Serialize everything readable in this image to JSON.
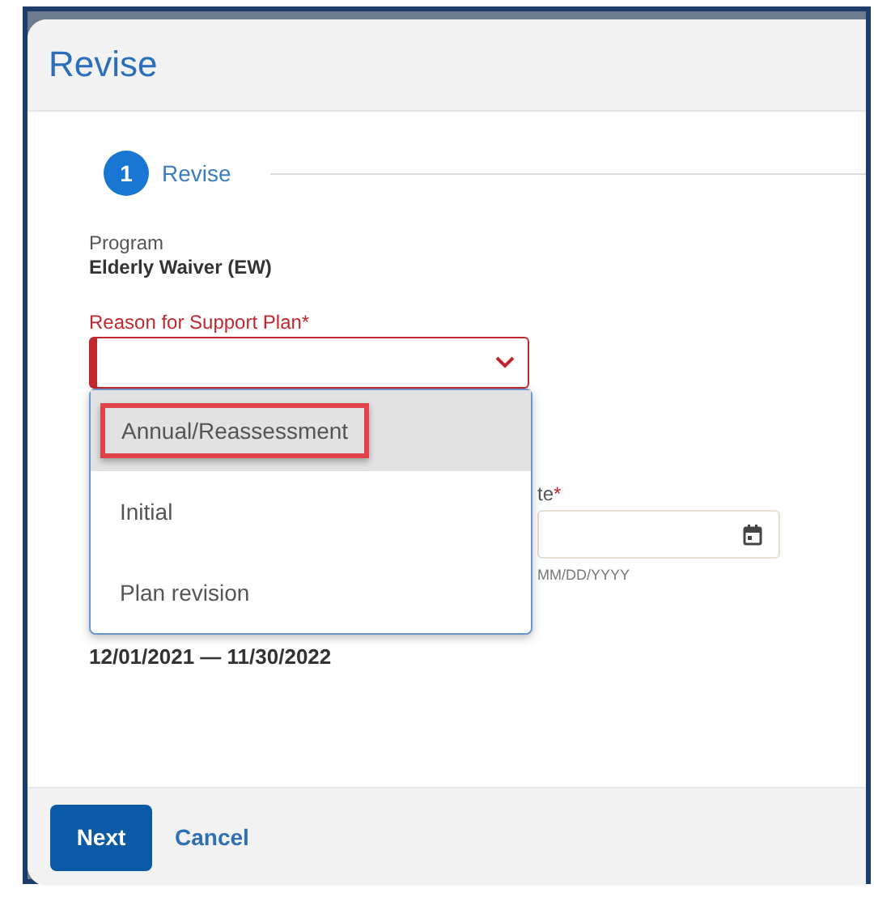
{
  "dialog": {
    "title": "Revise"
  },
  "stepper": [
    {
      "number": "1",
      "label": "Revise",
      "active": true
    }
  ],
  "program": {
    "label": "Program",
    "value": "Elderly Waiver (EW)"
  },
  "reason_field": {
    "label": "Reason for Support Plan*",
    "invalid": true,
    "expanded": true,
    "options": [
      {
        "label": "Annual/Reassessment",
        "hovered": true,
        "annotated": true
      },
      {
        "label": "Initial",
        "hovered": false,
        "annotated": false
      },
      {
        "label": "Plan revision",
        "hovered": false,
        "annotated": false
      }
    ]
  },
  "date_field": {
    "label": "te",
    "required_mark": "*",
    "hint": "MM/DD/YYYY"
  },
  "date_range": "12/01/2021 — 11/30/2022",
  "buttons": [
    {
      "label": "Next",
      "kind": "primary"
    },
    {
      "label": "Cancel",
      "kind": "link"
    }
  ]
}
